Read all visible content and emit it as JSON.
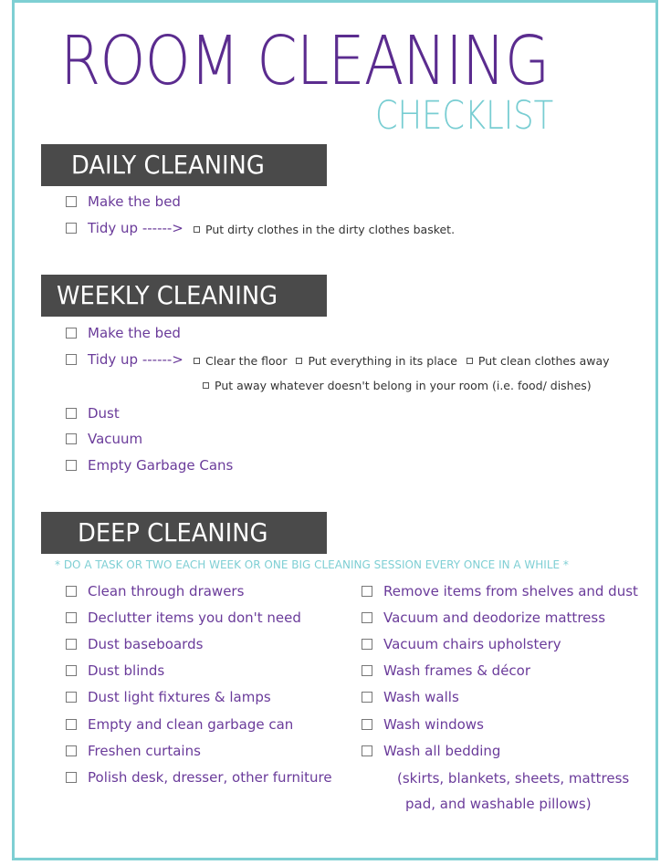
{
  "title": "ROOM CLEANING",
  "subtitle": "CHECKLIST",
  "colors": {
    "title": "#5b2c8f",
    "accent": "#78cdd2",
    "header_bg": "#4a4a4a",
    "item_text": "#6a3b9a"
  },
  "daily": {
    "header": "DAILY CLEANING",
    "items": [
      {
        "label": "Make the bed"
      },
      {
        "label": "Tidy up ------>",
        "subtasks": [
          "Put dirty clothes in the dirty clothes basket."
        ]
      }
    ]
  },
  "weekly": {
    "header": "WEEKLY CLEANING",
    "items": [
      {
        "label": "Make the bed"
      },
      {
        "label": "Tidy up ------>",
        "subtasks": [
          "Clear the floor",
          "Put everything in its place",
          "Put clean clothes away",
          "Put away whatever doesn't belong in your room (i.e. food/ dishes)"
        ]
      },
      {
        "label": "Dust"
      },
      {
        "label": "Vacuum"
      },
      {
        "label": "Empty Garbage Cans"
      }
    ]
  },
  "deep": {
    "header": "DEEP CLEANING",
    "note": "* DO A TASK OR TWO EACH WEEK OR ONE BIG CLEANING SESSION EVERY ONCE IN A WHILE *",
    "left_items": [
      "Clean through drawers",
      "Declutter items you don't need",
      "Dust baseboards",
      "Dust blinds",
      "Dust light fixtures & lamps",
      "Empty and clean garbage can",
      "Freshen curtains",
      "Polish desk, dresser, other furniture"
    ],
    "right_items": [
      "Remove items from shelves and dust",
      "Vacuum and deodorize mattress",
      "Vacuum chairs upholstery",
      "Wash frames & décor",
      "Wash walls",
      "Wash windows",
      "Wash all bedding"
    ],
    "bedding_detail_line1": "(skirts, blankets, sheets, mattress",
    "bedding_detail_line2": "pad, and washable pillows)"
  }
}
